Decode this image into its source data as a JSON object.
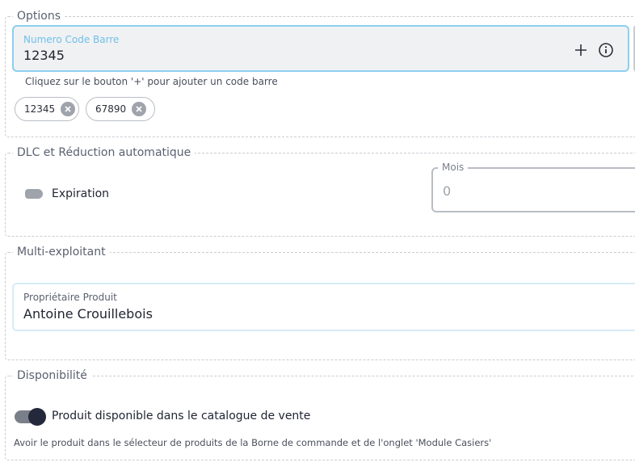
{
  "options": {
    "legend": "Options",
    "barcode_field": {
      "label": "Numero Code Barre",
      "value": "12345",
      "add_icon": "plus-icon",
      "info_icon": "info-icon"
    },
    "helper": "Cliquez sur le bouton '+' pour ajouter un code barre",
    "chips": [
      {
        "label": "12345",
        "delete_icon": "close-circle-icon"
      },
      {
        "label": "67890",
        "delete_icon": "close-circle-icon"
      }
    ]
  },
  "dlc": {
    "legend": "DLC et Réduction automatique",
    "expiration_label": "Expiration",
    "expiration_on": false,
    "mois_field": {
      "label": "Mois",
      "value": "0"
    }
  },
  "multi": {
    "legend": "Multi-exploitant",
    "owner_field": {
      "label": "Propriétaire Produit",
      "value": "Antoine Crouillebois"
    }
  },
  "dispo": {
    "legend": "Disponibilité",
    "toggle_label": "Produit disponible dans le catalogue de vente",
    "toggle_on": true,
    "helper": "Avoir le produit dans le sélecteur de produits de la Borne de commande et de l'onglet 'Module Casiers'"
  },
  "colors": {
    "accent": "#8ccff0",
    "field_bg": "#f0f1f3",
    "toggle_on": "#23283a",
    "toggle_off": "#9fa3ab"
  }
}
